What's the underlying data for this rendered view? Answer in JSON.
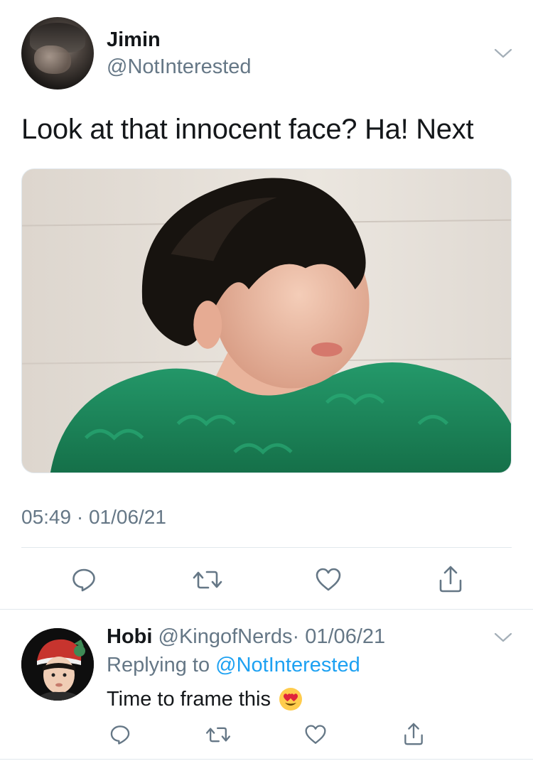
{
  "tweet": {
    "author": {
      "name": "Jimin",
      "handle": "@NotInterested"
    },
    "text": "Look at that innocent face? Ha! Next",
    "timestamp": "05:49 · 01/06/21",
    "media_icon": "photo-of-person-in-green-sweater",
    "actions": [
      "reply-icon",
      "retweet-icon",
      "like-icon",
      "share-icon"
    ]
  },
  "reply": {
    "author": {
      "name": "Hobi",
      "handle": "@KingofNerds",
      "date": "· 01/06/21"
    },
    "replying_prefix": "Replying to",
    "replying_mention": "@NotInterested",
    "text": "Time to frame this",
    "emoji": "heart-eyes-emoji",
    "actions": [
      "reply-icon",
      "retweet-icon",
      "like-icon",
      "share-icon"
    ]
  },
  "colors": {
    "text": "#14171a",
    "muted": "#657786",
    "link": "#1da1f2",
    "divider": "#e1e8ed",
    "sweater": "#1f8a5c"
  }
}
